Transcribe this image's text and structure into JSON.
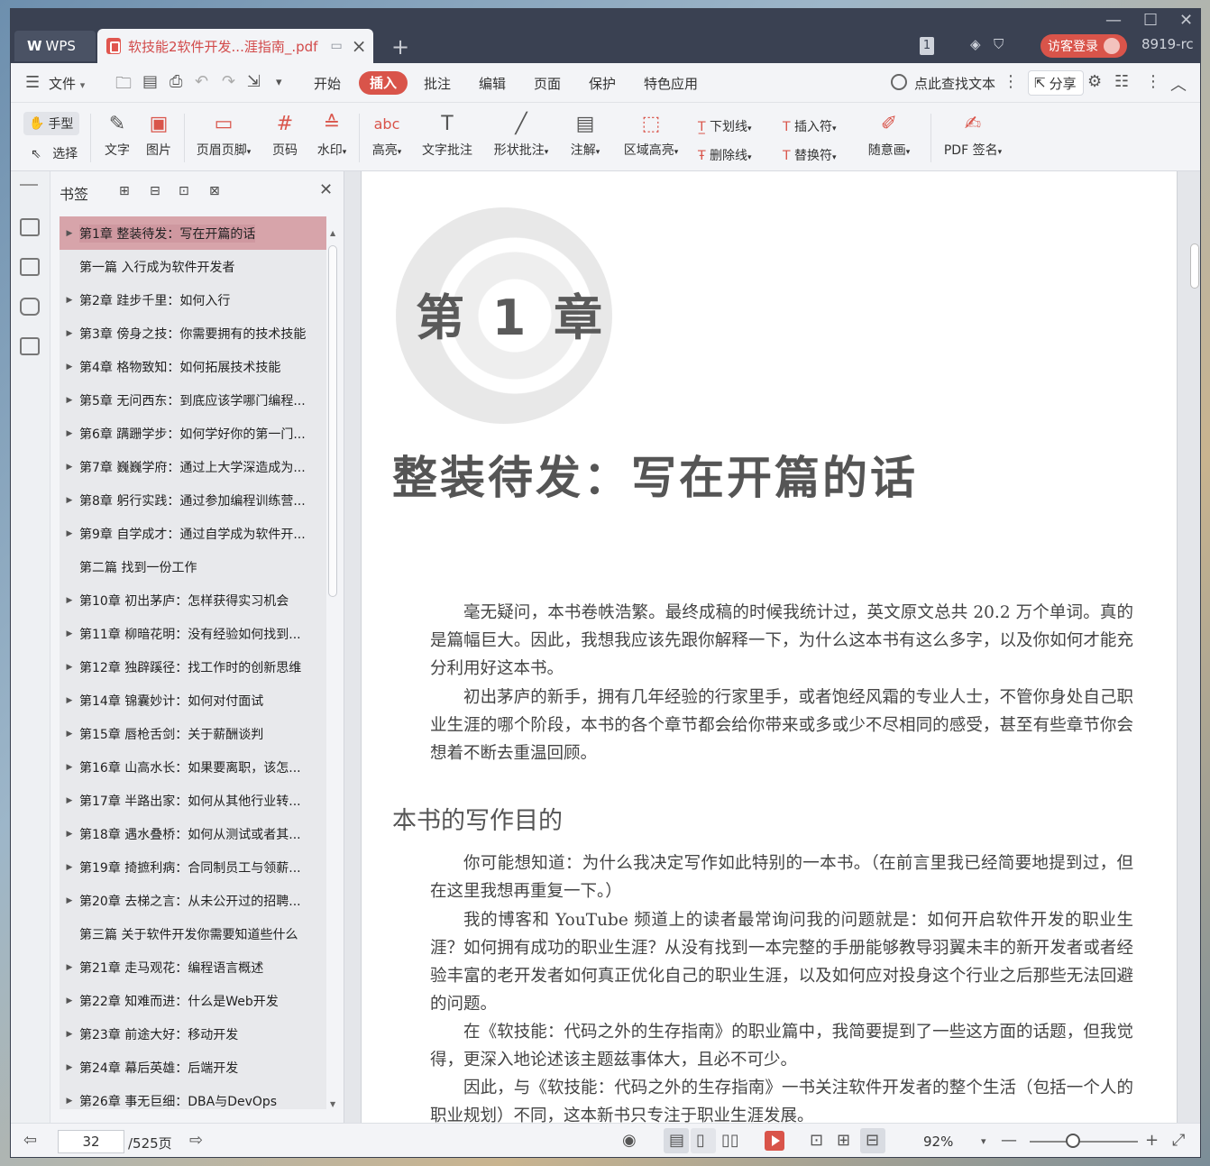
{
  "titlebar": {
    "app_label": "WPS",
    "doc_tab_title": "软技能2软件开发...涯指南_.pdf",
    "new_tab_symbol": "+",
    "badge_count": "1",
    "login_label": "访客登录",
    "user_id": "8919-rc"
  },
  "menubar": {
    "file_label": "文件",
    "items": [
      "开始",
      "插入",
      "批注",
      "编辑",
      "页面",
      "保护",
      "特色应用"
    ],
    "active_item": "插入",
    "search_label": "点此查找文本",
    "share_label": "分享"
  },
  "toolbar": {
    "hand_label": "手型",
    "select_label": "选择",
    "text_label": "文字",
    "image_label": "图片",
    "header_footer_label": "页眉页脚",
    "page_num_label": "页码",
    "watermark_label": "水印",
    "highlight_label": "高亮",
    "text_comment_label": "文字批注",
    "shape_comment_label": "形状批注",
    "annotate_label": "注解",
    "area_highlight_label": "区域高亮",
    "underline_label": "下划线",
    "strikethrough_label": "删除线",
    "insert_mark_label": "插入符",
    "replace_mark_label": "替换符",
    "freehand_label": "随意画",
    "pdf_sign_label": "PDF 签名"
  },
  "bookmarks": {
    "title": "书签",
    "items": [
      {
        "text": "第1章 整装待发：写在开篇的话",
        "arrow": true,
        "selected": true
      },
      {
        "text": "第一篇 入行成为软件开发者",
        "arrow": false
      },
      {
        "text": "第2章 跬步千里：如何入行",
        "arrow": true
      },
      {
        "text": "第3章 傍身之技：你需要拥有的技术技能",
        "arrow": true
      },
      {
        "text": "第4章 格物致知：如何拓展技术技能",
        "arrow": true
      },
      {
        "text": "第5章 无问西东：到底应该学哪门编程...",
        "arrow": true
      },
      {
        "text": "第6章 蹒跚学步：如何学好你的第一门...",
        "arrow": true
      },
      {
        "text": "第7章 巍巍学府：通过上大学深造成为...",
        "arrow": true
      },
      {
        "text": "第8章 躬行实践：通过参加编程训练营...",
        "arrow": true
      },
      {
        "text": "第9章 自学成才：通过自学成为软件开...",
        "arrow": true
      },
      {
        "text": "第二篇 找到一份工作",
        "arrow": false
      },
      {
        "text": "第10章 初出茅庐：怎样获得实习机会",
        "arrow": true
      },
      {
        "text": "第11章 柳暗花明：没有经验如何找到...",
        "arrow": true
      },
      {
        "text": "第12章 独辟蹊径：找工作时的创新思维",
        "arrow": true
      },
      {
        "text": "第14章 锦囊妙计：如何对付面试",
        "arrow": true
      },
      {
        "text": "第15章 唇枪舌剑：关于薪酬谈判",
        "arrow": true
      },
      {
        "text": "第16章 山高水长：如果要离职，该怎...",
        "arrow": true
      },
      {
        "text": "第17章 半路出家：如何从其他行业转...",
        "arrow": true
      },
      {
        "text": "第18章 遇水叠桥：如何从测试或者其...",
        "arrow": true
      },
      {
        "text": "第19章 掎摭利病：合同制员工与领薪...",
        "arrow": true
      },
      {
        "text": "第20章 去梯之言：从未公开过的招聘...",
        "arrow": true
      },
      {
        "text": "第三篇 关于软件开发你需要知道些什么",
        "arrow": false
      },
      {
        "text": "第21章 走马观花：编程语言概述",
        "arrow": true
      },
      {
        "text": "第22章 知难而进：什么是Web开发",
        "arrow": true
      },
      {
        "text": "第23章 前途大好：移动开发",
        "arrow": true
      },
      {
        "text": "第24章 幕后英雄：后端开发",
        "arrow": true
      },
      {
        "text": "第26章 事无巨细：DBA与DevOps",
        "arrow": true
      }
    ]
  },
  "document": {
    "chapter_label": "第 1 章",
    "chapter_title": "整装待发：写在开篇的话",
    "para1": "毫无疑问，本书卷帙浩繁。最终成稿的时候我统计过，英文原文总共 20.2 万个单词。真的是篇幅巨大。因此，我想我应该先跟你解释一下，为什么这本书有这么多字，以及你如何才能充分利用好这本书。",
    "para2": "初出茅庐的新手，拥有几年经验的行家里手，或者饱经风霜的专业人士，不管你身处自己职业生涯的哪个阶段，本书的各个章节都会给你带来或多或少不尽相同的感受，甚至有些章节你会想着不断去重温回顾。",
    "section_title": "本书的写作目的",
    "para3": "你可能想知道：为什么我决定写作如此特别的一本书。（在前言里我已经简要地提到过，但在这里我想再重复一下。）",
    "para4": "我的博客和 YouTube 频道上的读者最常询问我的问题就是：如何开启软件开发的职业生涯？如何拥有成功的职业生涯？从没有找到一本完整的手册能够教导羽翼未丰的新开发者或者经验丰富的老开发者如何真正优化自己的职业生涯，以及如何应对投身这个行业之后那些无法回避的问题。",
    "para5": "在《软技能：代码之外的生存指南》的职业篇中，我简要提到了一些这方面的话题，但我觉得，更深入地论述该主题兹事体大，且必不可少。",
    "para6": "因此，与《软技能：代码之外的生存指南》一书关注软件开发者的整个生活（包括一个人的职业规划）不同，这本新书只专注于职业生涯发展。"
  },
  "statusbar": {
    "current_page": "32",
    "total_pages": "/525页",
    "zoom": "92%"
  },
  "colors": {
    "accent": "#d9544a",
    "titlebar_bg": "#3a4152",
    "selected_bookmark": "#d7a4aa"
  }
}
